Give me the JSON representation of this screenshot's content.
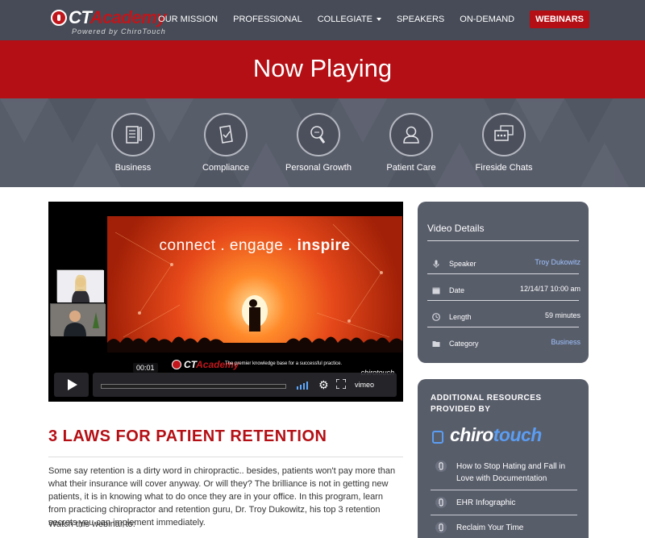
{
  "header": {
    "logo_brand_prefix": "CT",
    "logo_brand_suffix": "Academy",
    "logo_tagline": "Powered by ChiroTouch",
    "nav": [
      {
        "label": "OUR MISSION"
      },
      {
        "label": "PROFESSIONAL"
      },
      {
        "label": "COLLEGIATE"
      },
      {
        "label": "SPEAKERS"
      },
      {
        "label": "ON-DEMAND"
      },
      {
        "label": "WEBINARS"
      }
    ]
  },
  "banner": {
    "title": "Now Playing"
  },
  "categories": [
    {
      "label": "Business",
      "icon": "notebook-icon"
    },
    {
      "label": "Compliance",
      "icon": "document-check-icon"
    },
    {
      "label": "Personal Growth",
      "icon": "lightbulb-icon"
    },
    {
      "label": "Patient Care",
      "icon": "person-icon"
    },
    {
      "label": "Fireside Chats",
      "icon": "chat-bubbles-icon"
    }
  ],
  "video": {
    "slide_title_light": "connect . engage . ",
    "slide_title_bold": "inspire",
    "slide_logo_prefix": "CT",
    "slide_logo_suffix": "Academy",
    "slide_tagline": "The premier knowledge base for a successful practice.",
    "slide_footer_brand": "chirotouch",
    "timecode": "00:01",
    "player_brand": "vimeo"
  },
  "article": {
    "title": "3 LAWS FOR PATIENT RETENTION",
    "body": "Some say retention is a dirty word in chiropractic.. besides, patients won't pay more than what their insurance will cover anyway. Or will they? The brilliance is not in getting new patients, it is in knowing what to do once they are in your office. In this program, learn from practicing chiropractor and retention guru, Dr. Troy Dukowitz, his top 3 retention secrets you can implement immediately.",
    "watch_intro": "Watch this webinar to:"
  },
  "details": {
    "heading": "Video Details",
    "rows": [
      {
        "key": "Speaker",
        "value": "Troy Dukowitz",
        "icon": "microphone-icon"
      },
      {
        "key": "Date",
        "value": "12/14/17 10:00 am",
        "icon": "calendar-icon"
      },
      {
        "key": "Length",
        "value": "59 minutes",
        "icon": "clock-icon"
      },
      {
        "key": "Category",
        "value": "Business",
        "icon": "folder-icon"
      }
    ]
  },
  "resources": {
    "heading": "ADDITIONAL RESOURCES PROVIDED BY",
    "logo_a": "chiro",
    "logo_b": "touch",
    "items": [
      {
        "label": "How to Stop Hating and Fall in Love with Documentation"
      },
      {
        "label": "EHR Infographic"
      },
      {
        "label": "Reclaim Your Time"
      }
    ]
  },
  "colors": {
    "brand_red": "#b40f15",
    "panel_gray": "#585d6a",
    "header_gray": "#464b57",
    "link_blue": "#9fc3ff"
  }
}
